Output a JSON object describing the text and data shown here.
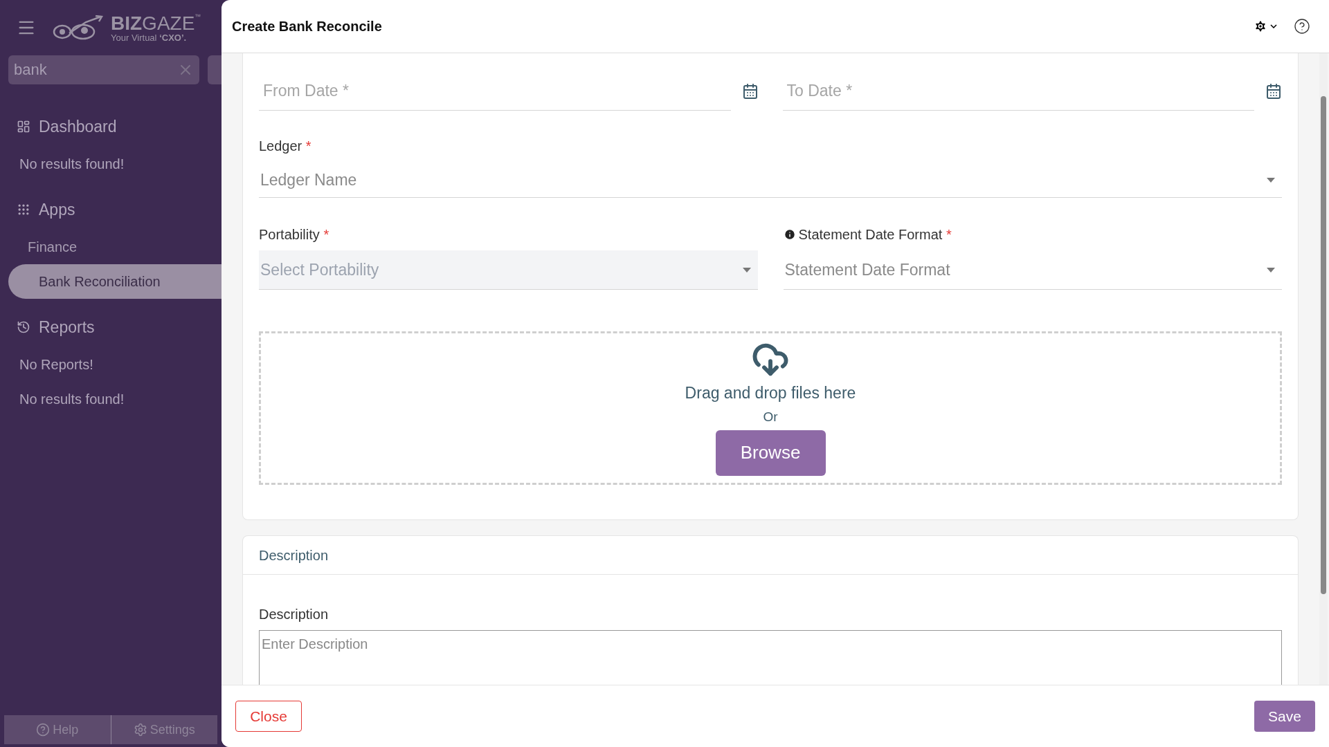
{
  "sidebar": {
    "logo": {
      "brand_bold": "BIZ",
      "brand": "GAZE",
      "trademark": "™",
      "tagline": "Your Virtual",
      "tagline_bold": "‘CXO’."
    },
    "search": {
      "value": "bank"
    },
    "sections": [
      {
        "title": "Dashboard",
        "kind": "dashboard",
        "items": [
          {
            "label": "No results found!",
            "kind": "empty",
            "selected": false
          }
        ]
      },
      {
        "title": "Apps",
        "kind": "apps",
        "items": [
          {
            "label": "Finance",
            "kind": "group",
            "selected": false
          },
          {
            "label": "Bank Reconciliation",
            "kind": "link",
            "selected": true
          }
        ]
      },
      {
        "title": "Reports",
        "kind": "reports",
        "items": [
          {
            "label": "No Reports!",
            "kind": "empty",
            "selected": false
          },
          {
            "label": "No results found!",
            "kind": "empty",
            "selected": false
          }
        ]
      }
    ],
    "footer": [
      {
        "label": "Help",
        "kind": "help"
      },
      {
        "label": "Settings",
        "kind": "settings"
      }
    ]
  },
  "panel": {
    "title": "Create Bank Reconcile",
    "from_date": {
      "placeholder": "From Date *"
    },
    "to_date": {
      "placeholder": "To Date *"
    },
    "ledger": {
      "label": "Ledger",
      "required_mark": "*",
      "placeholder": "Ledger Name"
    },
    "portability": {
      "label": "Portability",
      "required_mark": "*",
      "placeholder": "Select Portability",
      "disabled": true
    },
    "statement_date_format": {
      "label": "Statement Date Format",
      "required_mark": "*",
      "placeholder": "Statement Date Format",
      "disabled": false
    },
    "dropzone": {
      "text": "Drag and drop files here",
      "or": "Or",
      "button": "Browse"
    },
    "description_card": {
      "title": "Description",
      "label": "Description",
      "placeholder": "Enter Description"
    },
    "footer": {
      "close": "Close",
      "save": "Save"
    }
  }
}
